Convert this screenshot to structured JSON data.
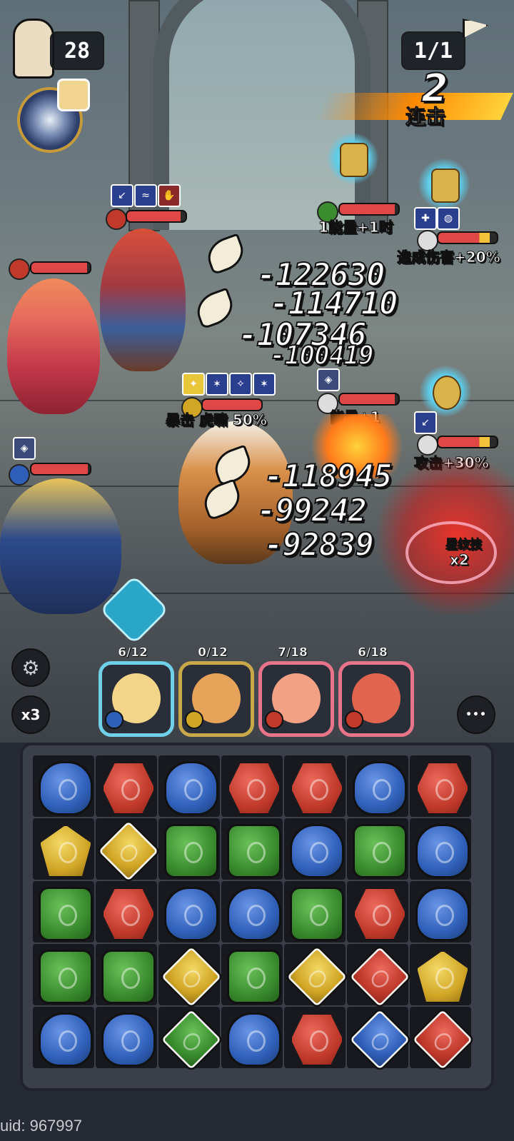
{
  "hud": {
    "moves_left": "28",
    "wave": "1/1",
    "combo_count": "2",
    "combo_label": "连击"
  },
  "enemy_labels": {
    "energy_time": "1能量+1时",
    "damage_up": "造成伤害+20%",
    "energy": "能量+1",
    "attack_up": "攻击+30%",
    "star_skill": "星纹技",
    "star_skill_mult": "x2"
  },
  "skill_callout": "暴击 虎啸 50%",
  "damage_numbers_top": [
    "-122630",
    "-114710",
    "-107346",
    "-100419"
  ],
  "damage_numbers_bottom": [
    "-118945",
    "-99242",
    "-92839"
  ],
  "controls": {
    "speed": "x3",
    "more": "•••"
  },
  "heroes": [
    {
      "name": "paladin",
      "energy": "6/12",
      "element": "blue",
      "border": "#6fd0e8"
    },
    {
      "name": "tiger",
      "energy": "0/12",
      "element": "yellow",
      "border": "#c9a84a"
    },
    {
      "name": "princess",
      "energy": "7/18",
      "element": "red",
      "border": "#e8748a"
    },
    {
      "name": "dragon-warrior",
      "energy": "6/18",
      "element": "red",
      "border": "#e8748a"
    }
  ],
  "board": [
    [
      "blue",
      "red",
      "blue",
      "red",
      "red",
      "blue",
      "red"
    ],
    [
      "yellow",
      "yellow*",
      "green",
      "green",
      "blue",
      "green",
      "blue"
    ],
    [
      "green",
      "red",
      "blue",
      "blue",
      "green",
      "red",
      "blue"
    ],
    [
      "green",
      "green",
      "yellow*",
      "green",
      "yellow*",
      "red*",
      "yellow"
    ],
    [
      "blue",
      "blue",
      "green*",
      "blue",
      "red",
      "blue*",
      "red*"
    ]
  ],
  "uid": "uid: 967997",
  "colors": {
    "red": "#c0392b",
    "blue": "#2f5fb8",
    "green": "#3a8c2f",
    "yellow": "#d1a625"
  }
}
